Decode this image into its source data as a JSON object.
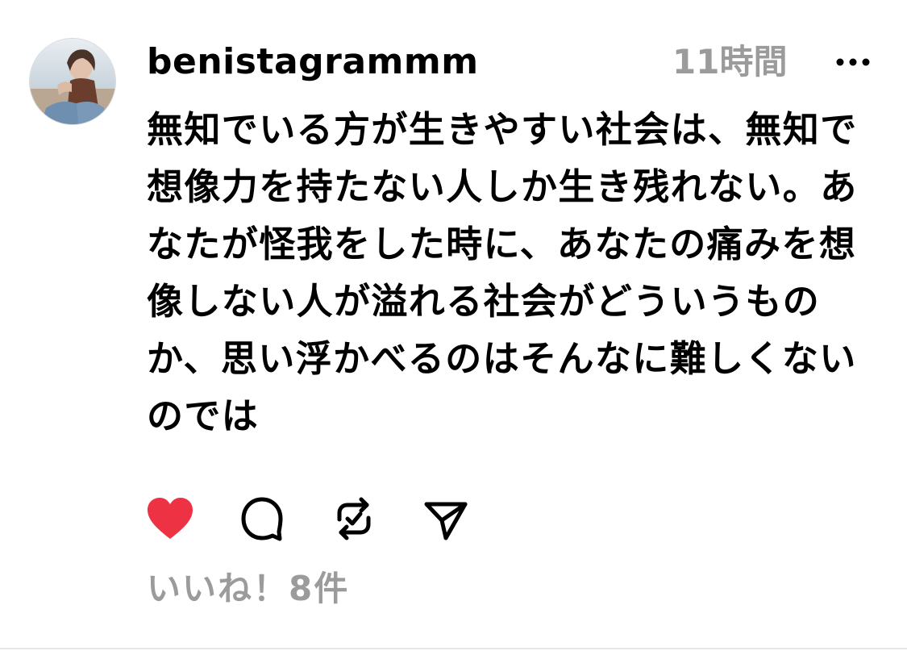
{
  "post": {
    "username": "benistagrammm",
    "time": "11時間",
    "more_icon": "more-horizontal-icon",
    "text": "無知でいる方が生きやすい社会は、無知で想像力を持たない人しか生き残れない。あなたが怪我をした時に、あなたの痛みを想像しない人が溢れる社会がどういうものか、思い浮かべるのはそんなに難しくないのでは",
    "likes_label": "いいね！8件"
  },
  "actions": {
    "like_icon": "heart-filled-icon",
    "comment_icon": "comment-icon",
    "repost_icon": "repost-icon",
    "share_icon": "send-icon"
  },
  "colors": {
    "text": "#000000",
    "muted": "#9b9b9b",
    "heart": "#ed3343",
    "divider": "#e6e6e6"
  }
}
